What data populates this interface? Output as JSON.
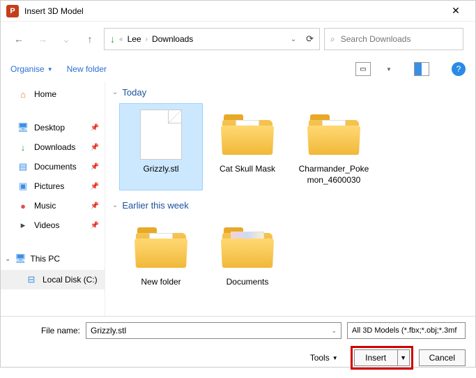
{
  "window": {
    "app_glyph": "P",
    "title": "Insert 3D Model",
    "close": "✕"
  },
  "nav": {
    "back": "←",
    "fwd": "→",
    "recent": "⌄",
    "up": "↑"
  },
  "breadcrumb": {
    "crumb1": "Lee",
    "crumb2": "Downloads",
    "sep": "›",
    "dropdown": "⌄",
    "refresh": "⟳"
  },
  "search": {
    "placeholder": "Search Downloads",
    "icon": "⌕"
  },
  "toolbar": {
    "organise": "Organise",
    "newfolder": "New folder",
    "help": "?"
  },
  "sidebar": {
    "home": "Home",
    "desktop": "Desktop",
    "downloads": "Downloads",
    "documents": "Documents",
    "pictures": "Pictures",
    "music": "Music",
    "videos": "Videos",
    "thispc": "This PC",
    "localdisk": "Local Disk (C:)"
  },
  "groups": {
    "today": "Today",
    "earlier": "Earlier this week"
  },
  "files": {
    "grizzly": "Grizzly.stl",
    "catskull": "Cat Skull Mask",
    "charmander": "Charmander_Pokemon_4600030",
    "newfolder": "New folder",
    "documents": "Documents"
  },
  "footer": {
    "filename_label": "File name:",
    "filename_value": "Grizzly.stl",
    "filter": "All 3D Models (*.fbx;*.obj;*.3mf",
    "tools": "Tools",
    "insert": "Insert",
    "cancel": "Cancel"
  }
}
